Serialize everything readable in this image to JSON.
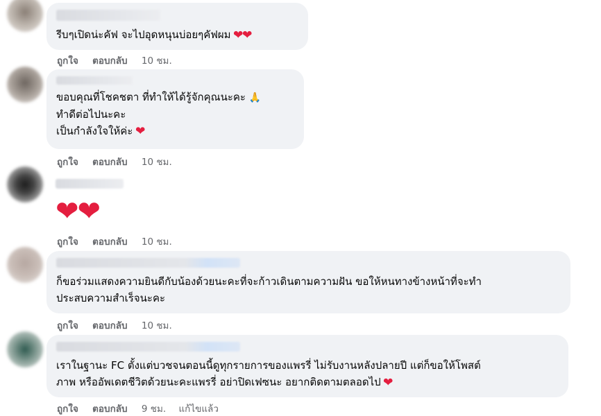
{
  "comments": [
    {
      "lines": [
        "รีบๆเปิดน่ะคัฟ จะไปอุดหนุนบ่อยๆคัฟผม"
      ],
      "icons": [
        "heart-icon",
        "heart-icon"
      ],
      "actions": {
        "like": "ถูกใจ",
        "reply": "ตอบกลับ",
        "time": "10 ชม."
      }
    },
    {
      "lines": [
        "ขอบคุณที่โชคชตา ที่ทำให้ได้รู้จักคุณนะคะ",
        "ทำดีต่อไปนะคะ",
        "เป็นกำลังใจให้ค่ะ"
      ],
      "icons": [
        "pray-icon",
        "heart-icon"
      ],
      "actions": {
        "like": "ถูกใจ",
        "reply": "ตอบกลับ",
        "time": "10 ชม."
      }
    },
    {
      "lines": [],
      "icons": [
        "heart-icon",
        "heart-icon"
      ],
      "actions": {
        "like": "ถูกใจ",
        "reply": "ตอบกลับ",
        "time": "10 ชม."
      }
    },
    {
      "lines": [
        "ก็ขอร่วมแสดงความยินดีกับน้องด้วยนะคะที่จะก้าวเดินตามความฝัน ขอให้หนทางข้างหน้าที่จะทำ",
        "ประสบความสำเร็จนะคะ"
      ],
      "icons": [],
      "actions": {
        "like": "ถูกใจ",
        "reply": "ตอบกลับ",
        "time": "10 ชม."
      }
    },
    {
      "lines": [
        "เราในฐานะ FC ตั้งแต่บวชจนตอนนี้ดูทุกรายการของแพรรี่ ไม่รับงานหลังปลายปี แต่ก็ขอให้โพสต์",
        "ภาพ หรืออัพเดตชีวิตด้วยนะคะแพรรี่ อย่าปิดเฟซนะ อยากติดตามตลอดไป"
      ],
      "icons": [
        "heart-icon"
      ],
      "actions": {
        "like": "ถูกใจ",
        "reply": "ตอบกลับ",
        "time": "9 ชม.",
        "edited": "แก้ไขแล้ว"
      }
    }
  ],
  "colors": {
    "bubble": "#f0f2f5",
    "text": "#050505",
    "meta": "#65676b",
    "heart": "#e41e3f"
  }
}
